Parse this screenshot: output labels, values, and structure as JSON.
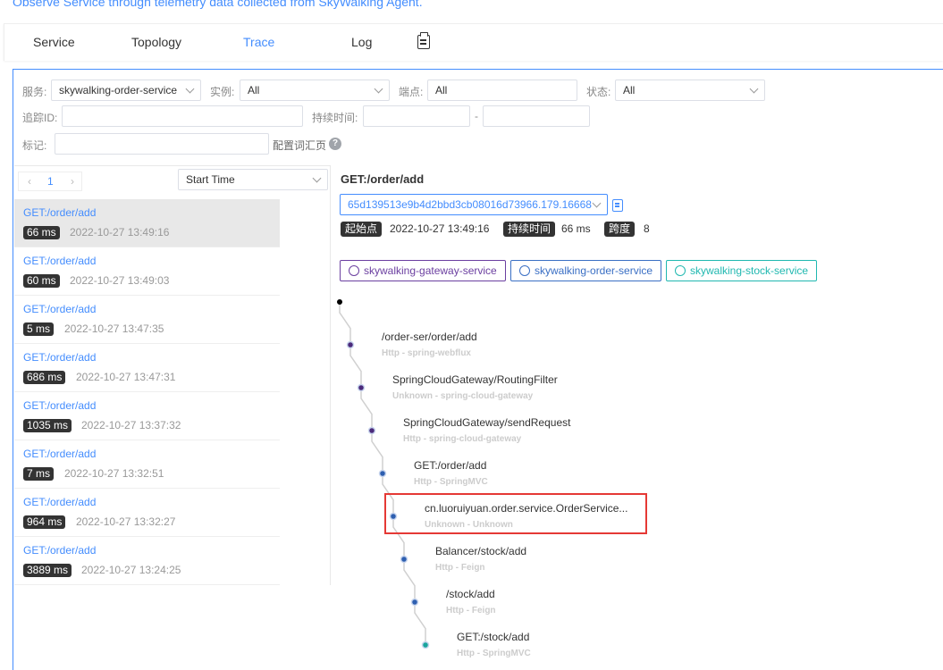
{
  "header": {
    "subtitle": "Observe Service through telemetry data collected from SkyWalking Agent."
  },
  "nav": {
    "tabs": [
      {
        "label": "Service"
      },
      {
        "label": "Topology"
      },
      {
        "label": "Trace"
      },
      {
        "label": "Log"
      }
    ],
    "active": "Trace"
  },
  "filters": {
    "service_label": "服务:",
    "service_value": "skywalking-order-service",
    "instance_label": "实例:",
    "instance_value": "All",
    "endpoint_label": "端点:",
    "endpoint_value": "All",
    "status_label": "状态:",
    "status_value": "All",
    "trace_id_label": "追踪ID:",
    "duration_label": "持续时间:",
    "duration_sep": "-",
    "tags_label": "标记:",
    "tags_config_link": "配置词汇页"
  },
  "list": {
    "page": "1",
    "prev": "‹",
    "next": "›",
    "sort_value": "Start Time",
    "items": [
      {
        "name": "GET:/order/add",
        "duration": "66 ms",
        "time": "2022-10-27 13:49:16"
      },
      {
        "name": "GET:/order/add",
        "duration": "60 ms",
        "time": "2022-10-27 13:49:03"
      },
      {
        "name": "GET:/order/add",
        "duration": "5 ms",
        "time": "2022-10-27 13:47:35"
      },
      {
        "name": "GET:/order/add",
        "duration": "686 ms",
        "time": "2022-10-27 13:47:31"
      },
      {
        "name": "GET:/order/add",
        "duration": "1035 ms",
        "time": "2022-10-27 13:37:32"
      },
      {
        "name": "GET:/order/add",
        "duration": "7 ms",
        "time": "2022-10-27 13:32:51"
      },
      {
        "name": "GET:/order/add",
        "duration": "964 ms",
        "time": "2022-10-27 13:32:27"
      },
      {
        "name": "GET:/order/add",
        "duration": "3889 ms",
        "time": "2022-10-27 13:24:25"
      }
    ]
  },
  "detail": {
    "title": "GET:/order/add",
    "trace_id": "65d139513e9b4d2bbd3cb08016d73966.179.16668",
    "start_label": "起始点",
    "start_value": "2022-10-27 13:49:16",
    "duration_label": "持续时间",
    "duration_value": "66 ms",
    "span_label": "跨度",
    "span_value": "8",
    "services": [
      {
        "name": "skywalking-gateway-service",
        "color": "#6b3fa0"
      },
      {
        "name": "skywalking-order-service",
        "color": "#3a6fc4"
      },
      {
        "name": "skywalking-stock-service",
        "color": "#20b8b0"
      }
    ],
    "spans": [
      {
        "name": "/order-ser/order/add",
        "sub": "Http - spring-webflux",
        "color": "#4b2a7b"
      },
      {
        "name": "SpringCloudGateway/RoutingFilter",
        "sub": "Unknown - spring-cloud-gateway",
        "color": "#4b2a7b"
      },
      {
        "name": "SpringCloudGateway/sendRequest",
        "sub": "Http - spring-cloud-gateway",
        "color": "#4b2a7b"
      },
      {
        "name": "GET:/order/add",
        "sub": "Http - SpringMVC",
        "color": "#2e5fb0"
      },
      {
        "name": "cn.luoruiyuan.order.service.OrderService...",
        "sub": "Unknown - Unknown",
        "color": "#2e5fb0"
      },
      {
        "name": "Balancer/stock/add",
        "sub": "Http - Feign",
        "color": "#2e5fb0"
      },
      {
        "name": "/stock/add",
        "sub": "Http - Feign",
        "color": "#2e5fb0"
      },
      {
        "name": "GET:/stock/add",
        "sub": "Http - SpringMVC",
        "color": "#1aa59d"
      }
    ]
  }
}
